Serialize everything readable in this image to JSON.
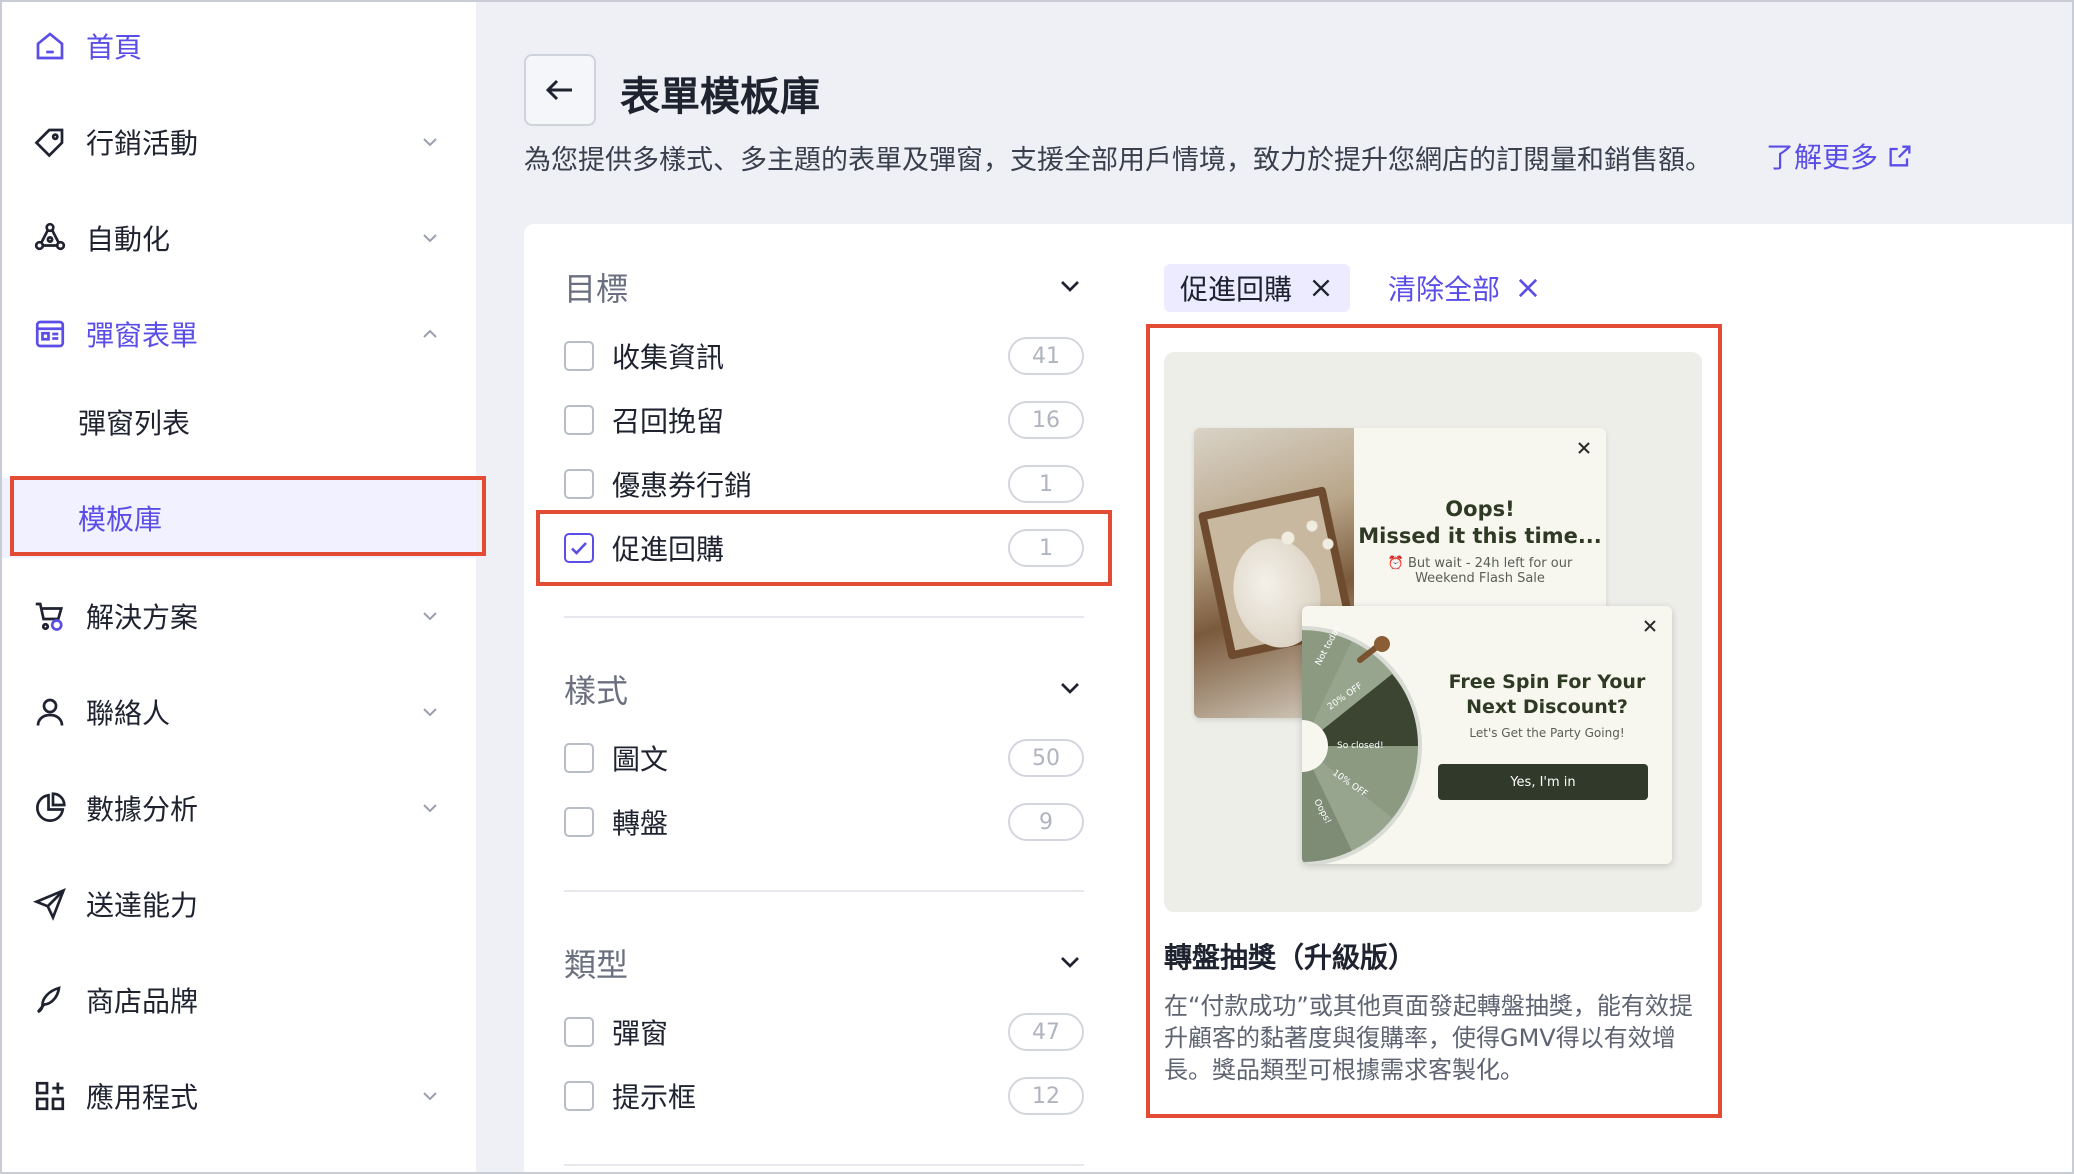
{
  "sidebar": {
    "items": [
      {
        "label": "首頁",
        "icon": "home-icon",
        "active": true,
        "chevron": false
      },
      {
        "label": "行銷活動",
        "icon": "tag-icon",
        "active": false,
        "chevron": "down"
      },
      {
        "label": "自動化",
        "icon": "automation-icon",
        "active": false,
        "chevron": "down"
      },
      {
        "label": "彈窗表單",
        "icon": "form-icon",
        "active": true,
        "chevron": "up"
      },
      {
        "label": "解決方案",
        "icon": "cart-icon",
        "active": false,
        "chevron": "down"
      },
      {
        "label": "聯絡人",
        "icon": "person-icon",
        "active": false,
        "chevron": "down"
      },
      {
        "label": "數據分析",
        "icon": "pie-chart-icon",
        "active": false,
        "chevron": "down"
      },
      {
        "label": "送達能力",
        "icon": "send-icon",
        "active": false,
        "chevron": false
      },
      {
        "label": "商店品牌",
        "icon": "brand-icon",
        "active": false,
        "chevron": false
      },
      {
        "label": "應用程式",
        "icon": "apps-icon",
        "active": false,
        "chevron": "down"
      }
    ],
    "sub_items": [
      {
        "label": "彈窗列表",
        "selected": false
      },
      {
        "label": "模板庫",
        "selected": true
      }
    ]
  },
  "header": {
    "title": "表單模板庫",
    "description": "為您提供多樣式、多主題的表單及彈窗，支援全部用戶情境，致力於提升您網店的訂閱量和銷售額。",
    "learn_more": "了解更多"
  },
  "filters": {
    "goal": {
      "title": "目標",
      "options": [
        {
          "label": "收集資訊",
          "count": "41",
          "checked": false
        },
        {
          "label": "召回挽留",
          "count": "16",
          "checked": false
        },
        {
          "label": "優惠券行銷",
          "count": "1",
          "checked": false
        },
        {
          "label": "促進回購",
          "count": "1",
          "checked": true
        }
      ]
    },
    "style": {
      "title": "樣式",
      "options": [
        {
          "label": "圖文",
          "count": "50",
          "checked": false
        },
        {
          "label": "轉盤",
          "count": "9",
          "checked": false
        }
      ]
    },
    "type": {
      "title": "類型",
      "options": [
        {
          "label": "彈窗",
          "count": "47",
          "checked": false
        },
        {
          "label": "提示框",
          "count": "12",
          "checked": false
        }
      ]
    }
  },
  "active_filters": {
    "tag": "促進回購",
    "clear_all": "清除全部"
  },
  "template": {
    "title": "轉盤抽獎（升級版）",
    "description": "在“付款成功”或其他頁面發起轉盤抽獎，能有效提升顧客的黏著度與復購率，使得GMV得以有效增長。獎品類型可根據需求客製化。",
    "preview": {
      "back_title_1": "Oops!",
      "back_title_2": "Missed it this time...",
      "back_sub_1": "⏰ But wait - 24h left for our",
      "back_sub_2": "Weekend Flash Sale",
      "front_title_1": "Free Spin For Your",
      "front_title_2": "Next Discount?",
      "front_sub": "Let's Get the Party Going!",
      "front_button": "Yes, I'm in",
      "wheel_labels": [
        "Not today",
        "20% OFF",
        "So closed!",
        "10% OFF",
        "Oops!"
      ]
    }
  },
  "colors": {
    "accent": "#5b4ee8",
    "highlight": "#e34b34",
    "popup_dark": "#30392a"
  }
}
